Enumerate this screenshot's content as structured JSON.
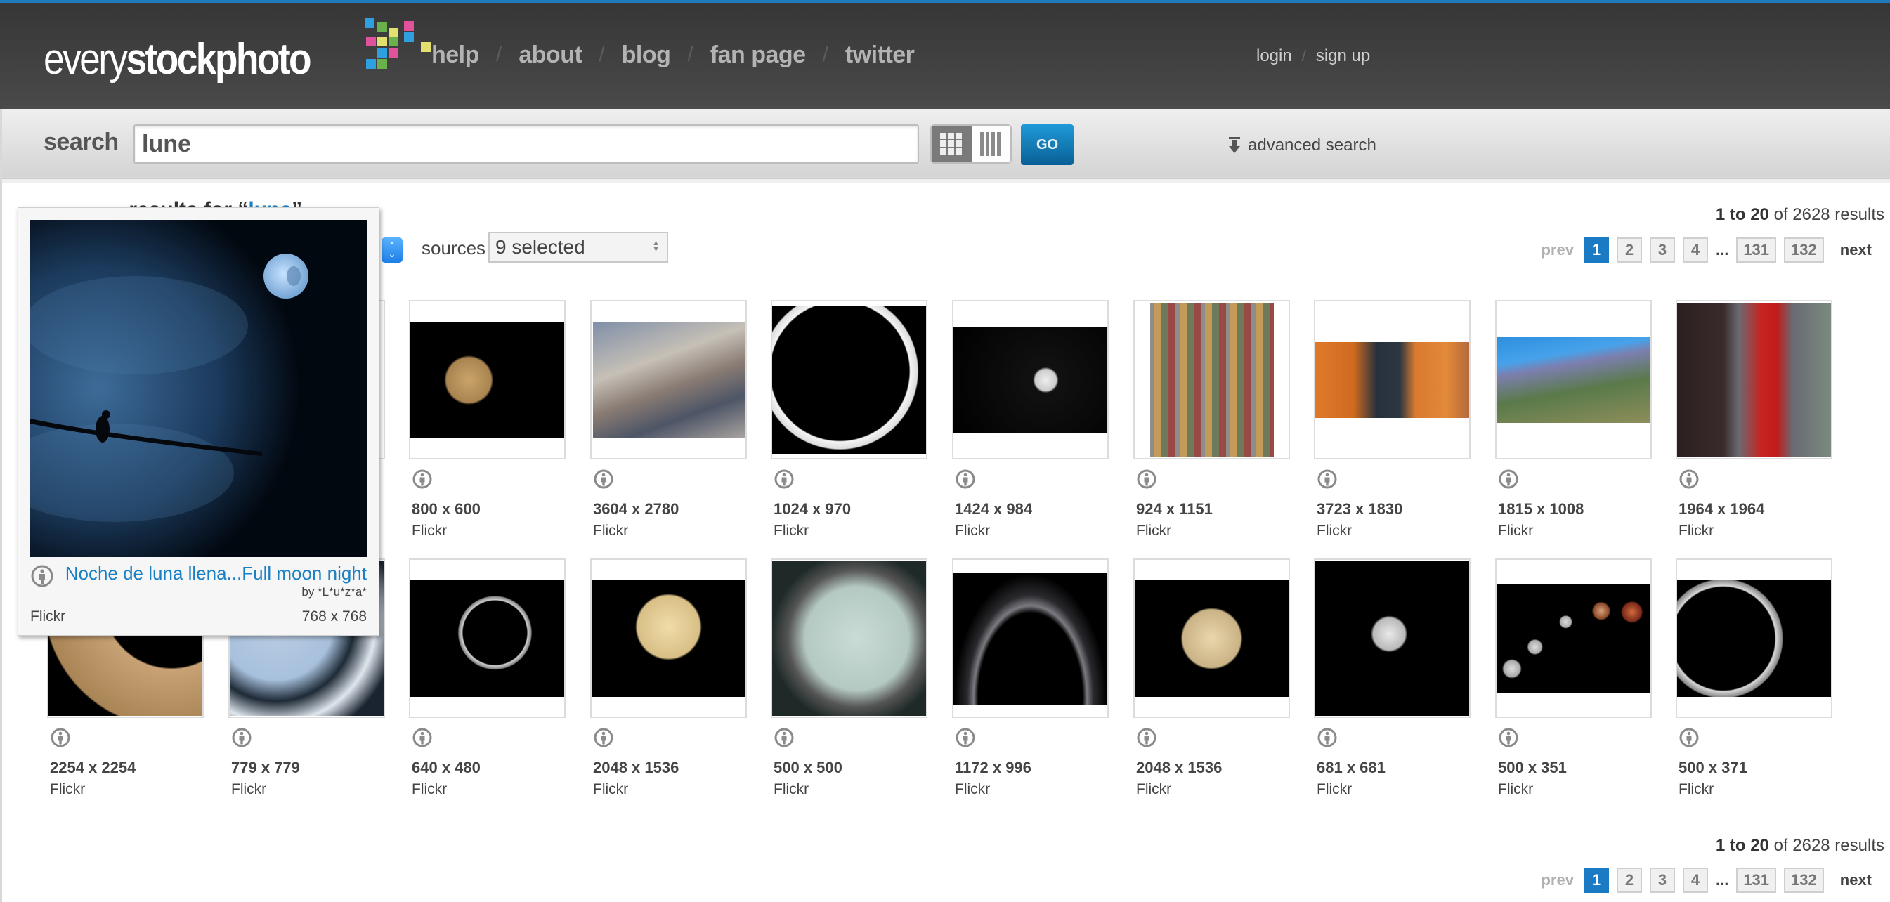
{
  "header": {
    "logo": {
      "thin": "every",
      "bold": "stockphoto"
    },
    "nav": [
      {
        "label": "help"
      },
      {
        "label": "about"
      },
      {
        "label": "blog"
      },
      {
        "label": "fan page"
      },
      {
        "label": "twitter"
      }
    ],
    "nav_separator": "/",
    "account": {
      "login": "login",
      "signup": "sign up",
      "separator": "/"
    },
    "colors": {
      "accent_bar": "#1f7bbd",
      "background": "#3f3f3f"
    }
  },
  "search": {
    "label": "search",
    "value": "lune",
    "view_grid_icon": "grid-view-icon",
    "view_columns_icon": "column-view-icon",
    "go_label": "GO",
    "advanced_label": "advanced search"
  },
  "results": {
    "heading_prefix": "... results for “",
    "query": "lune",
    "heading_suffix": "”",
    "range": "1 to 20",
    "of_text": "of 2628 results",
    "sources_label": "sources",
    "sources_value": "9 selected"
  },
  "pagination": {
    "prev": "prev",
    "pages": [
      "1",
      "2",
      "3",
      "4"
    ],
    "ellipsis": "...",
    "last_pages": [
      "131",
      "132"
    ],
    "current": "1",
    "next": "next",
    "active_color": "#1a7bc4"
  },
  "popup": {
    "title": "Noche de luna llena...Full moon night",
    "author": "by *L*u*z*a*",
    "source": "Flickr",
    "dims": "768 x 768",
    "license_icon": "creative-commons-person-icon"
  },
  "grid": {
    "rows": [
      [
        {
          "dims": "",
          "source": "",
          "hidden": true
        },
        {
          "dims": "",
          "source": "",
          "hidden": true
        },
        {
          "dims": "800 x 600",
          "source": "Flickr",
          "subject": "golden-full-moon"
        },
        {
          "dims": "3604 x 2780",
          "source": "Flickr",
          "subject": "surreal-painting"
        },
        {
          "dims": "1024 x 970",
          "source": "Flickr",
          "subject": "crescent-moon-large"
        },
        {
          "dims": "1424 x 984",
          "source": "Flickr",
          "subject": "crescent-moon-small"
        },
        {
          "dims": "924 x 1151",
          "source": "Flickr",
          "subject": "photo-mosaic"
        },
        {
          "dims": "3723 x 1830",
          "source": "Flickr",
          "subject": "astronaut-toys"
        },
        {
          "dims": "1815 x 1008",
          "source": "Flickr",
          "subject": "flower-hillside"
        },
        {
          "dims": "1964 x 1964",
          "source": "Flickr",
          "subject": "child-in-red"
        }
      ],
      [
        {
          "dims": "2254 x 2254",
          "source": "Flickr",
          "subject": "gibbous-moon"
        },
        {
          "dims": "779 x 779",
          "source": "Flickr",
          "subject": "snowy-pine-moon"
        },
        {
          "dims": "640 x 480",
          "source": "Flickr",
          "subject": "thin-crescent"
        },
        {
          "dims": "2048 x 1536",
          "source": "Flickr",
          "subject": "moon-behind-branches"
        },
        {
          "dims": "500 x 500",
          "source": "Flickr",
          "subject": "melies-moon-face"
        },
        {
          "dims": "1172 x 996",
          "source": "Flickr",
          "subject": "earthshine-arc"
        },
        {
          "dims": "2048 x 1536",
          "source": "Flickr",
          "subject": "full-beige-moon"
        },
        {
          "dims": "681 x 681",
          "source": "Flickr",
          "subject": "grey-full-moon"
        },
        {
          "dims": "500 x 351",
          "source": "Flickr",
          "subject": "lunar-eclipse-sequence"
        },
        {
          "dims": "500 x 371",
          "source": "Flickr",
          "subject": "waxing-crescent"
        }
      ]
    ]
  }
}
